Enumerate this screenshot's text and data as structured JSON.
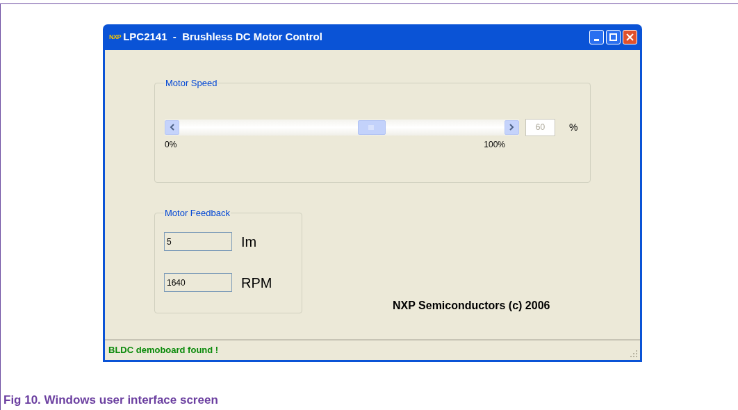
{
  "window": {
    "title": "LPC2141  -  Brushless DC Motor Control",
    "logo": "NXP"
  },
  "motor_speed": {
    "title": "Motor Speed",
    "slider": {
      "level": 0.6,
      "min_label": "0%",
      "max_label": "100%"
    },
    "value": "60",
    "unit": "%",
    "value_disabled": true
  },
  "motor_feedback": {
    "title": "Motor Feedback",
    "fields": [
      {
        "value": "5",
        "unit": "Im"
      },
      {
        "value": "1640",
        "unit": "RPM"
      }
    ]
  },
  "copyright": "NXP Semiconductors (c) 2006",
  "status_bar": {
    "text": "BLDC demoboard found !"
  },
  "caption": "Fig 10. Windows user interface screen"
}
